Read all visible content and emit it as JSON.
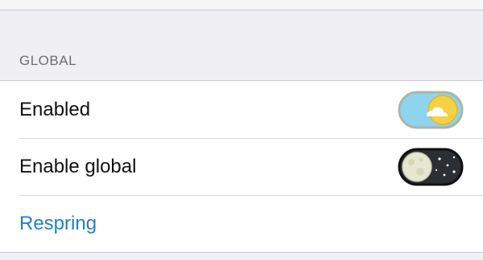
{
  "section": {
    "header": "GLOBAL"
  },
  "rows": [
    {
      "label": "Enabled",
      "toggle": {
        "state": "on",
        "theme": "day"
      }
    },
    {
      "label": "Enable global",
      "toggle": {
        "state": "off",
        "theme": "night"
      }
    }
  ],
  "action": {
    "label": "Respring"
  },
  "colors": {
    "background": "#efeff4",
    "link": "#1f7fc9",
    "day_track": "#8fd4ee",
    "sun": "#f6d141",
    "night_track": "#2b2f33",
    "moon": "#e6e8d2"
  }
}
